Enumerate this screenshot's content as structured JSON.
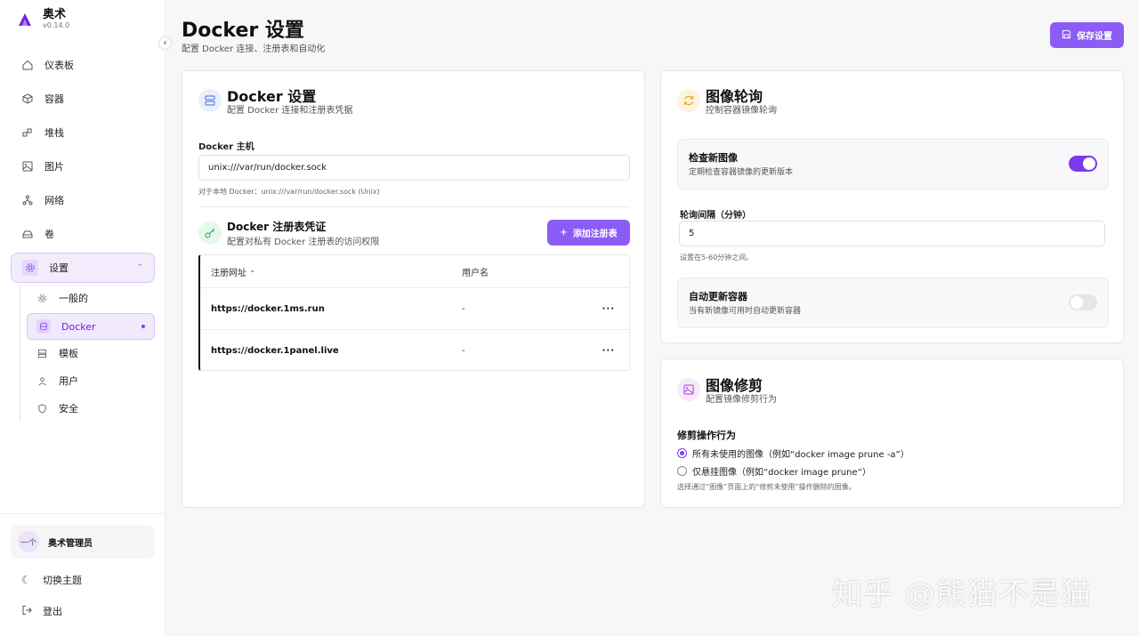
{
  "brand": {
    "name": "奥术",
    "version": "v0.14.0"
  },
  "nav": [
    {
      "label": "仪表板",
      "icon": "home-icon"
    },
    {
      "label": "容器",
      "icon": "box-icon"
    },
    {
      "label": "堆栈",
      "icon": "stack-icon"
    },
    {
      "label": "图片",
      "icon": "image-icon"
    },
    {
      "label": "网络",
      "icon": "network-icon"
    },
    {
      "label": "卷",
      "icon": "volume-icon"
    },
    {
      "label": "设置",
      "icon": "gear-icon"
    }
  ],
  "settings_sub": [
    {
      "label": "一般的",
      "icon": "gear-icon"
    },
    {
      "label": "Docker",
      "icon": "database-icon"
    },
    {
      "label": "模板",
      "icon": "template-icon"
    },
    {
      "label": "用户",
      "icon": "user-icon"
    },
    {
      "label": "安全",
      "icon": "shield-icon"
    }
  ],
  "user": {
    "name": "奥术管理员",
    "avatar_text": "一个"
  },
  "bottom_links": {
    "theme": "切换主题",
    "logout": "登出"
  },
  "header": {
    "title": "Docker 设置",
    "subtitle": "配置 Docker 连接、注册表和自动化",
    "save_label": "保存设置"
  },
  "docker_card": {
    "title": "Docker 设置",
    "subtitle": "配置 Docker 连接和注册表凭据",
    "host_label": "Docker 主机",
    "host_value": "unix:///var/run/docker.sock",
    "host_hint": "对于本地 Docker：unix:///var/run/docker.sock (Unix)"
  },
  "registry": {
    "title": "Docker 注册表凭证",
    "subtitle": "配置对私有 Docker 注册表的访问权限",
    "add_label": "添加注册表",
    "columns": {
      "url": "注册网址",
      "username": "用户名"
    },
    "rows": [
      {
        "url": "https://docker.1ms.run",
        "username": "-"
      },
      {
        "url": "https://docker.1panel.live",
        "username": "-"
      }
    ],
    "more": "···"
  },
  "polling_card": {
    "title": "图像轮询",
    "subtitle": "控制容器镜像轮询",
    "check_title": "检查新图像",
    "check_desc": "定期检查容器镜像的更新版本",
    "check_on": true,
    "interval_label": "轮询间隔（分钟）",
    "interval_value": "5",
    "interval_hint": "设置在5-60分钟之间。",
    "auto_title": "自动更新容器",
    "auto_desc": "当有新镜像可用时自动更新容器",
    "auto_on": false
  },
  "prune_card": {
    "title": "图像修剪",
    "subtitle": "配置镜像修剪行为",
    "behavior_label": "修剪操作行为",
    "options": [
      {
        "label": "所有未使用的图像（例如“docker image prune -a”）",
        "checked": true
      },
      {
        "label": "仅悬挂图像（例如“docker image prune”）",
        "checked": false
      }
    ],
    "hint": "选择通过“图像”页面上的“修剪未使用”操作删除的图像。"
  },
  "watermark": "知乎 @熊猫不是猫",
  "colors": {
    "accent": "#8b5cf6",
    "accent_dark": "#7c3aed"
  }
}
